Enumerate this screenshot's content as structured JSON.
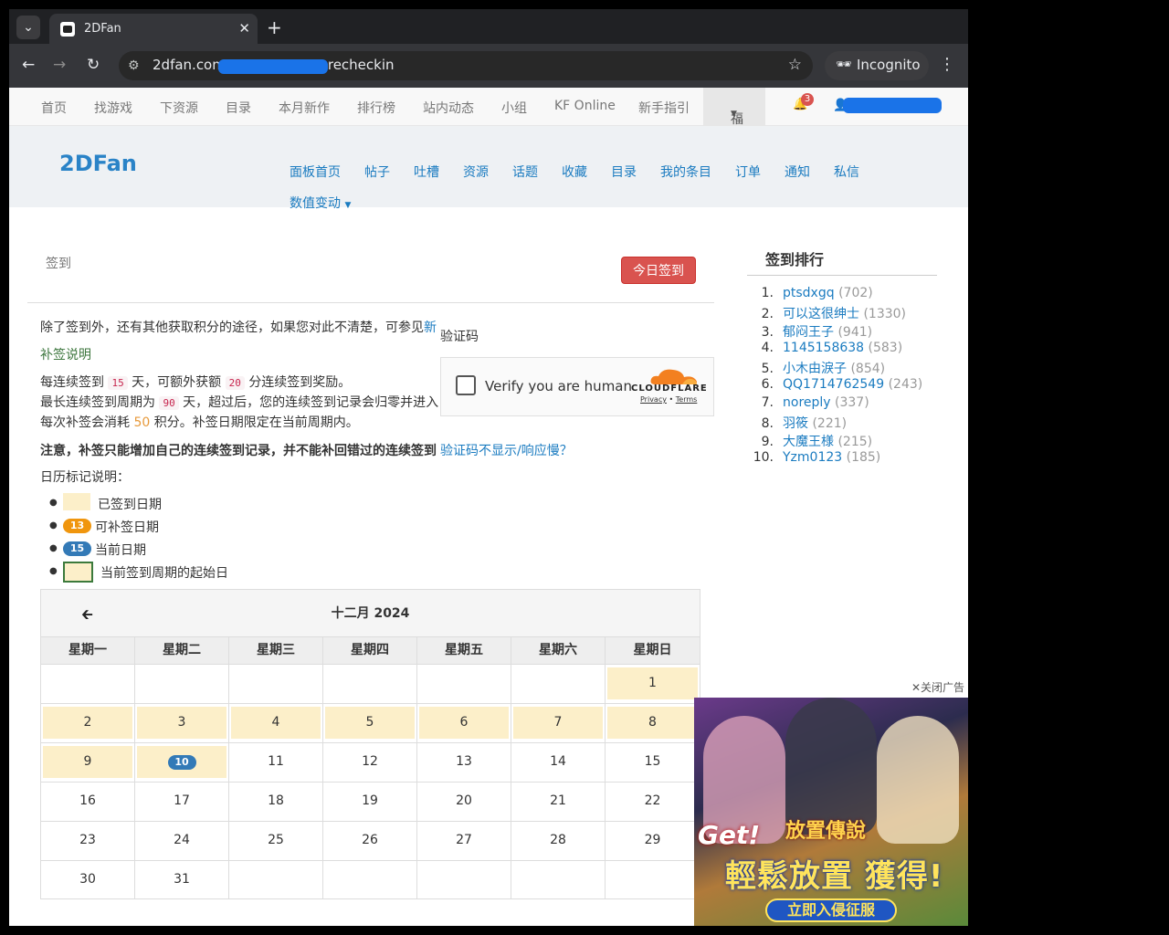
{
  "browser": {
    "tab_title": "2DFan",
    "url_prefix": "2dfan.com",
    "url_suffix": "recheckin",
    "incognito_label": "Incognito"
  },
  "site_nav": {
    "items": [
      "首页",
      "找游戏",
      "下资源",
      "目录",
      "本月新作",
      "排行榜",
      "站内动态",
      "小组",
      "KF Online",
      "新手指引"
    ],
    "fuli_label": "福利",
    "notification_count": "3"
  },
  "subheader": {
    "brand": "2DFan",
    "links": [
      "面板首页",
      "帖子",
      "吐槽",
      "资源",
      "话题",
      "收藏",
      "目录",
      "我的条目",
      "订单",
      "通知",
      "私信"
    ],
    "dropdown_label": "数值变动"
  },
  "checkin": {
    "section_title": "签到",
    "button_label": "今日签到",
    "intro": "除了签到外，还有其他获取积分的途径，如果您对此不清楚，可参见",
    "intro_link": "新",
    "makeup_title": "补签说明",
    "line1_a": "每连续签到",
    "line1_days": "15",
    "line1_b": "天，可额外获额",
    "line1_points": "20",
    "line1_c": "分连续签到奖励。",
    "line2_a": "最长连续签到周期为",
    "line2_days": "90",
    "line2_b": "天，超过后，您的连续签到记录会归零并进入",
    "line3_a": "每次补签会消耗",
    "line3_cost": "50",
    "line3_b": "积分。补签日期限定在当前周期内。",
    "notice": "注意，补签只能增加自己的连续签到记录，并不能补回错过的连续签到",
    "legend_title": "日历标记说明：",
    "legend": {
      "signed": "已签到日期",
      "makeup_num": "13",
      "makeup": "可补签日期",
      "current_num": "15",
      "current": "当前日期",
      "cycle_start": "当前签到周期的起始日"
    }
  },
  "captcha": {
    "label": "验证码",
    "checkbox_text": "Verify you are human",
    "brand": "CLOUDFLARE",
    "privacy": "Privacy",
    "terms": "Terms",
    "help_link": "验证码不显示/响应慢？"
  },
  "calendar": {
    "prev_icon": "arrow-left-icon",
    "title": "十二月 2024",
    "weekdays": [
      "星期一",
      "星期二",
      "星期三",
      "星期四",
      "星期五",
      "星期六",
      "星期日"
    ],
    "weeks": [
      [
        "",
        "",
        "",
        "",
        "",
        "",
        "1"
      ],
      [
        "2",
        "3",
        "4",
        "5",
        "6",
        "7",
        "8"
      ],
      [
        "9",
        "10",
        "11",
        "12",
        "13",
        "14",
        "15"
      ],
      [
        "16",
        "17",
        "18",
        "19",
        "20",
        "21",
        "22"
      ],
      [
        "23",
        "24",
        "25",
        "26",
        "27",
        "28",
        "29"
      ],
      [
        "30",
        "31",
        "",
        "",
        "",
        "",
        ""
      ]
    ],
    "signed_days": [
      "1",
      "2",
      "3",
      "4",
      "5",
      "6",
      "7",
      "8",
      "9",
      "10"
    ],
    "today": "10"
  },
  "ranking": {
    "title": "签到排行",
    "items": [
      {
        "rank": "1.",
        "name": "ptsdxgq",
        "score": "(702)"
      },
      {
        "rank": "2.",
        "name": "可以这很绅士",
        "score": "(1330)"
      },
      {
        "rank": "3.",
        "name": "郁闷王子",
        "score": "(941)"
      },
      {
        "rank": "4.",
        "name": "1145158638",
        "score": "(583)"
      },
      {
        "rank": "5.",
        "name": "小木由淚子",
        "score": "(854)"
      },
      {
        "rank": "6.",
        "name": "QQ1714762549",
        "score": "(243)"
      },
      {
        "rank": "7.",
        "name": "noreply",
        "score": "(337)"
      },
      {
        "rank": "8.",
        "name": "羽筱",
        "score": "(221)"
      },
      {
        "rank": "9.",
        "name": "大魔王様",
        "score": "(215)"
      },
      {
        "rank": "10.",
        "name": "Yzm0123",
        "score": "(185)"
      }
    ]
  },
  "ad": {
    "close_label": "✕关闭广告",
    "get_text": "Get!",
    "logo_text": "放置傳說",
    "slogan": "輕鬆放置 獲得!",
    "cta": "立即入侵征服"
  },
  "colors": {
    "signed_bg": "#fcefc9",
    "makeup_pill": "#f0960e",
    "current_pill": "#337ab7",
    "cycle_border": "#3c7a3c",
    "primary_button": "#d9534f"
  }
}
